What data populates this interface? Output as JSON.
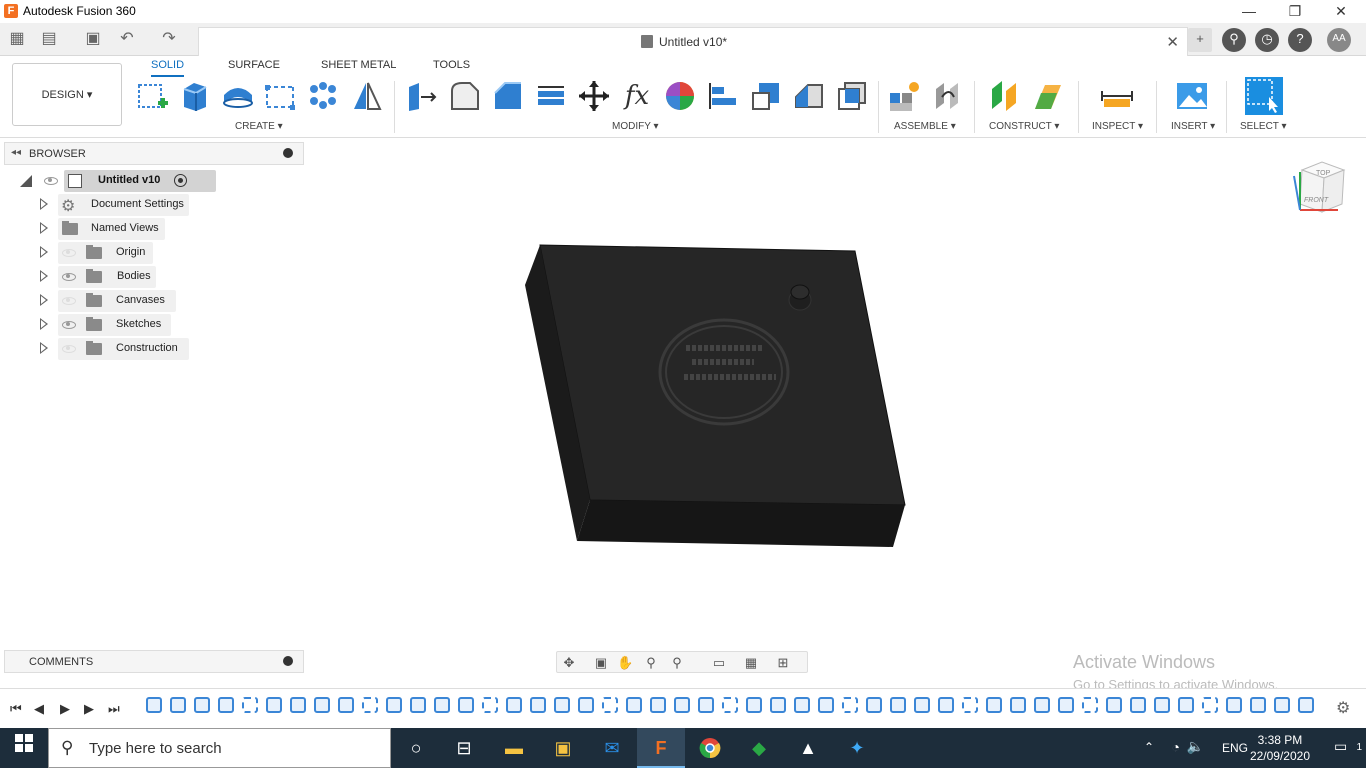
{
  "window": {
    "app_title": "Autodesk Fusion 360",
    "minimize": "—",
    "restore": "❐",
    "close": "✕"
  },
  "tabbar": {
    "doc_title": "Untitled v10*",
    "user_initials": "AA"
  },
  "ribbon": {
    "workspace": "DESIGN ▾",
    "tabs": [
      {
        "label": "SOLID",
        "active": true
      },
      {
        "label": "SURFACE",
        "active": false
      },
      {
        "label": "SHEET METAL",
        "active": false
      },
      {
        "label": "TOOLS",
        "active": false
      }
    ],
    "groups": {
      "create": "CREATE ▾",
      "modify": "MODIFY ▾",
      "assemble": "ASSEMBLE ▾",
      "construct": "CONSTRUCT ▾",
      "inspect": "INSPECT ▾",
      "insert": "INSERT ▾",
      "select": "SELECT ▾"
    }
  },
  "browser": {
    "header": "BROWSER",
    "root": "Untitled v10",
    "items": [
      {
        "label": "Document Settings",
        "icon": "gear-icon",
        "visible": null
      },
      {
        "label": "Named Views",
        "icon": "folder-icon",
        "visible": null
      },
      {
        "label": "Origin",
        "icon": "folder-icon",
        "visible": false
      },
      {
        "label": "Bodies",
        "icon": "folder-icon",
        "visible": true
      },
      {
        "label": "Canvases",
        "icon": "folder-icon",
        "visible": false
      },
      {
        "label": "Sketches",
        "icon": "folder-icon",
        "visible": true
      },
      {
        "label": "Construction",
        "icon": "folder-icon",
        "visible": false
      }
    ]
  },
  "comments": {
    "header": "COMMENTS"
  },
  "viewport": {
    "viewcube_top": "TOP",
    "viewcube_front": "FRONT",
    "body_color": "#232323"
  },
  "activate": {
    "line1": "Activate Windows",
    "line2": "Go to Settings to activate Windows."
  },
  "taskbar": {
    "search_placeholder": "Type here to search",
    "language": "ENG",
    "time": "3:38 PM",
    "date": "22/09/2020",
    "notification_count": "1"
  },
  "colors": {
    "accent": "#1070c0",
    "taskbar": "#1d2d3b",
    "select_icon": "#1a8ee0"
  }
}
